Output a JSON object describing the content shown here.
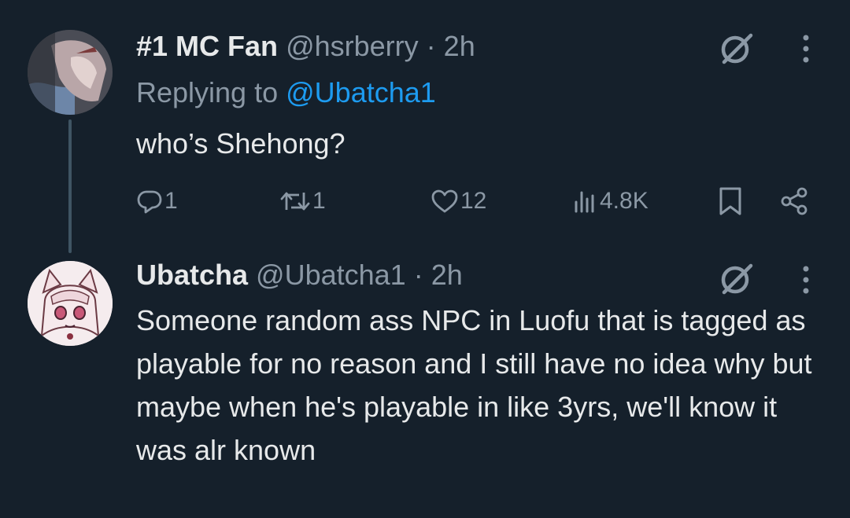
{
  "tweets": [
    {
      "display_name": "#1 MC Fan",
      "handle": "@hsrberry",
      "separator": "·",
      "time": "2h",
      "replying_prefix": "Replying to",
      "replying_to": "@Ubatcha1",
      "text": "who’s Shehong?",
      "actions": {
        "replies": "1",
        "reposts": "1",
        "likes": "12",
        "views": "4.8K"
      }
    },
    {
      "display_name": "Ubatcha",
      "handle": "@Ubatcha1",
      "separator": "·",
      "time": "2h",
      "text": "Someone random ass NPC in Luofu that is tagged as playable for no reason and I still have no idea why but maybe when he's playable in like 3yrs, we'll know it was alr known"
    }
  ],
  "colors": {
    "background": "#15202b",
    "primary_text": "#e7e9ea",
    "secondary_text": "#8b98a5",
    "accent": "#1d9bf0",
    "thread_line": "#3f5463"
  },
  "icons": [
    "grok-icon",
    "more-icon",
    "reply-icon",
    "repost-icon",
    "like-icon",
    "views-icon",
    "bookmark-icon",
    "share-icon"
  ]
}
